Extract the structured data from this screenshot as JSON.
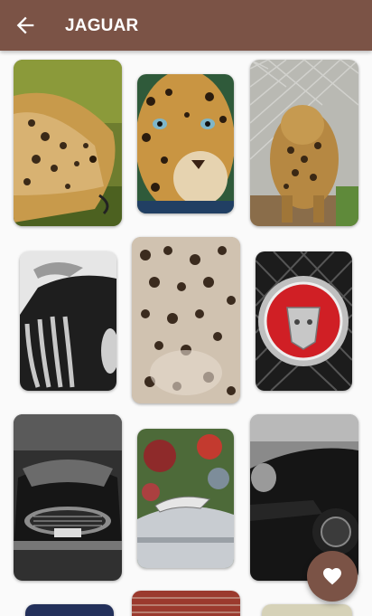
{
  "appbar": {
    "title": "JAGUAR",
    "back_icon": "arrow-back-icon"
  },
  "fab": {
    "icon": "heart-icon"
  },
  "gallery": {
    "items": [
      {
        "subject": "jaguar-head-side",
        "favorite": false
      },
      {
        "subject": "jaguar-face",
        "favorite": false
      },
      {
        "subject": "jaguar-walking",
        "favorite": false
      },
      {
        "subject": "jaguar-car-hood-ornament",
        "favorite": false
      },
      {
        "subject": "sepia-jaguar",
        "favorite": false
      },
      {
        "subject": "jaguar-badge-logo",
        "favorite": false
      },
      {
        "subject": "jaguar-car-front",
        "favorite": false
      },
      {
        "subject": "jaguar-leaper-ornament",
        "favorite": false
      },
      {
        "subject": "black-jaguar-car",
        "favorite": false
      },
      {
        "subject": "partial-image",
        "favorite": false
      },
      {
        "subject": "brick-building",
        "favorite": false
      },
      {
        "subject": "partial-image",
        "favorite": false
      }
    ]
  },
  "colors": {
    "primary": "#7b5346",
    "background": "#fafafa",
    "badge_red": "#d01f25"
  }
}
